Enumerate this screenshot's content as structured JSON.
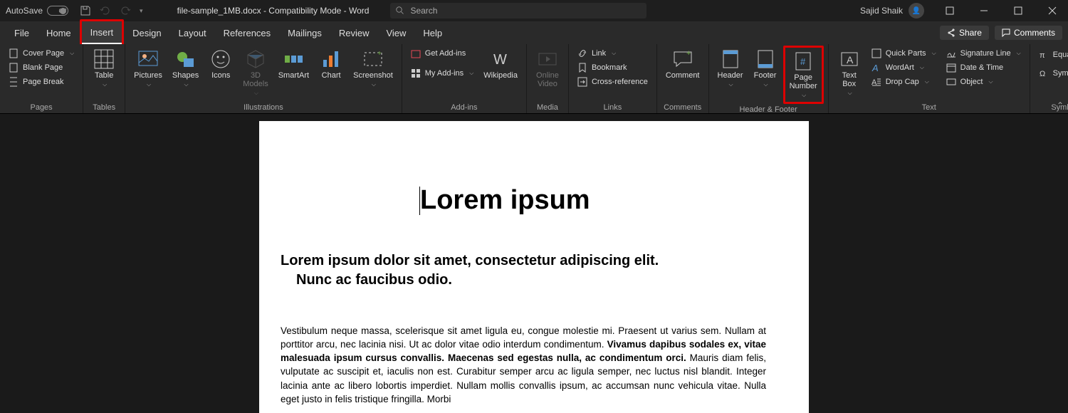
{
  "titlebar": {
    "autosave_label": "AutoSave",
    "autosave_state": "Off",
    "doc_title": "file-sample_1MB.docx - Compatibility Mode - Word",
    "search_placeholder": "Search",
    "user_name": "Sajid Shaik"
  },
  "tabs": {
    "file": "File",
    "home": "Home",
    "insert": "Insert",
    "design": "Design",
    "layout": "Layout",
    "references": "References",
    "mailings": "Mailings",
    "review": "Review",
    "view": "View",
    "help": "Help",
    "share": "Share",
    "comments": "Comments"
  },
  "ribbon": {
    "pages": {
      "label": "Pages",
      "cover_page": "Cover Page",
      "blank_page": "Blank Page",
      "page_break": "Page Break"
    },
    "tables": {
      "label": "Tables",
      "table": "Table"
    },
    "illustrations": {
      "label": "Illustrations",
      "pictures": "Pictures",
      "shapes": "Shapes",
      "icons": "Icons",
      "models": "3D\nModels",
      "smartart": "SmartArt",
      "chart": "Chart",
      "screenshot": "Screenshot"
    },
    "addins": {
      "label": "Add-ins",
      "get": "Get Add-ins",
      "my": "My Add-ins",
      "wikipedia": "Wikipedia"
    },
    "media": {
      "label": "Media",
      "online_video": "Online\nVideo"
    },
    "links": {
      "label": "Links",
      "link": "Link",
      "bookmark": "Bookmark",
      "cross_ref": "Cross-reference"
    },
    "comments": {
      "label": "Comments",
      "comment": "Comment"
    },
    "header_footer": {
      "label": "Header & Footer",
      "header": "Header",
      "footer": "Footer",
      "page_number": "Page\nNumber"
    },
    "text": {
      "label": "Text",
      "text_box": "Text\nBox",
      "quick_parts": "Quick Parts",
      "wordart": "WordArt",
      "drop_cap": "Drop Cap",
      "sig_line": "Signature Line",
      "date_time": "Date & Time",
      "object": "Object"
    },
    "symbols": {
      "label": "Symbols",
      "equation": "Equation",
      "symbol": "Symbol"
    }
  },
  "document": {
    "title": "Lorem ipsum",
    "subtitle_l1": "Lorem ipsum dolor sit amet, consectetur adipiscing elit.",
    "subtitle_l2": "Nunc ac faucibus odio.",
    "body_p1_a": "Vestibulum neque massa, scelerisque sit amet ligula eu, congue molestie mi. Praesent ut varius sem. Nullam at porttitor arcu, nec lacinia nisi. Ut ac dolor vitae odio interdum condimentum. ",
    "body_p1_b": "Vivamus dapibus sodales ex, vitae malesuada ipsum cursus convallis. Maecenas sed egestas nulla, ac condimentum orci.",
    "body_p1_c": " Mauris diam felis, vulputate ac suscipit et, iaculis non est. Curabitur semper arcu ac ligula semper, nec luctus nisl blandit. Integer lacinia ante ac libero lobortis imperdiet. Nullam mollis convallis ipsum, ac accumsan nunc vehicula vitae. Nulla eget justo in felis tristique fringilla. Morbi"
  }
}
